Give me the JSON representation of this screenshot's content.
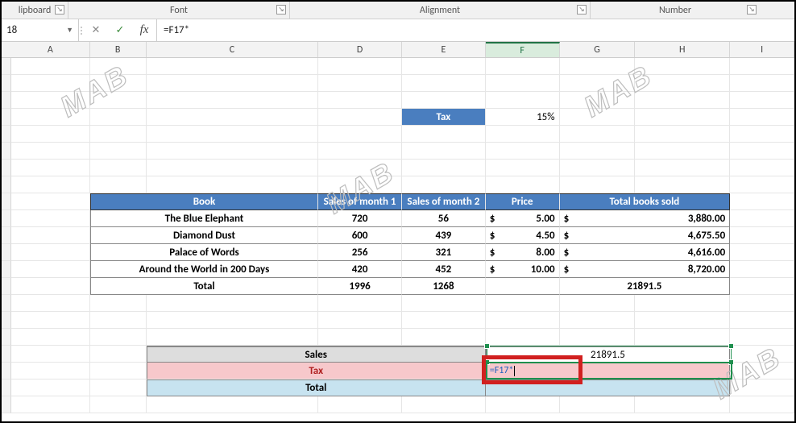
{
  "ribbon": {
    "groups": [
      "lipboard",
      "Font",
      "Alignment",
      "Number"
    ]
  },
  "nameBox": "18",
  "formulaBar": "=F17*",
  "fxLabel": "fx",
  "columns": [
    "A",
    "B",
    "C",
    "D",
    "E",
    "F",
    "G",
    "H",
    "I"
  ],
  "taxLabel": "Tax",
  "taxRate": "15%",
  "tableHdr": {
    "book": "Book",
    "m1": "Sales of month 1",
    "m2": "Sales of month 2",
    "price": "Price",
    "total": "Total books sold"
  },
  "books": [
    {
      "name": "The Blue Elephant",
      "m1": "720",
      "m2": "56",
      "price": "5.00",
      "total": "3,880.00"
    },
    {
      "name": "Diamond Dust",
      "m1": "600",
      "m2": "439",
      "price": "4.50",
      "total": "4,675.50"
    },
    {
      "name": "Palace of Words",
      "m1": "256",
      "m2": "321",
      "price": "8.00",
      "total": "4,616.00"
    },
    {
      "name": "Around the World in 200 Days",
      "m1": "420",
      "m2": "452",
      "price": "10.00",
      "total": "8,720.00"
    }
  ],
  "tableTotals": {
    "label": "Total",
    "m1": "1996",
    "m2": "1268",
    "grand": "21891.5"
  },
  "currency": "$",
  "summary": {
    "salesLabel": "Sales",
    "salesVal": "21891.5",
    "taxLabel": "Tax",
    "taxCell": "=F17*",
    "totalLabel": "Total"
  },
  "watermark": "MAB",
  "chart_data": {
    "type": "table",
    "title": "Book sales",
    "columns": [
      "Book",
      "Sales of month 1",
      "Sales of month 2",
      "Price",
      "Total books sold"
    ],
    "rows": [
      [
        "The Blue Elephant",
        720,
        56,
        5.0,
        3880.0
      ],
      [
        "Diamond Dust",
        600,
        439,
        4.5,
        4675.5
      ],
      [
        "Palace of Words",
        256,
        321,
        8.0,
        4616.0
      ],
      [
        "Around the World in 200 Days",
        420,
        452,
        10.0,
        8720.0
      ],
      [
        "Total",
        1996,
        1268,
        null,
        21891.5
      ]
    ],
    "tax_rate": 0.15
  }
}
